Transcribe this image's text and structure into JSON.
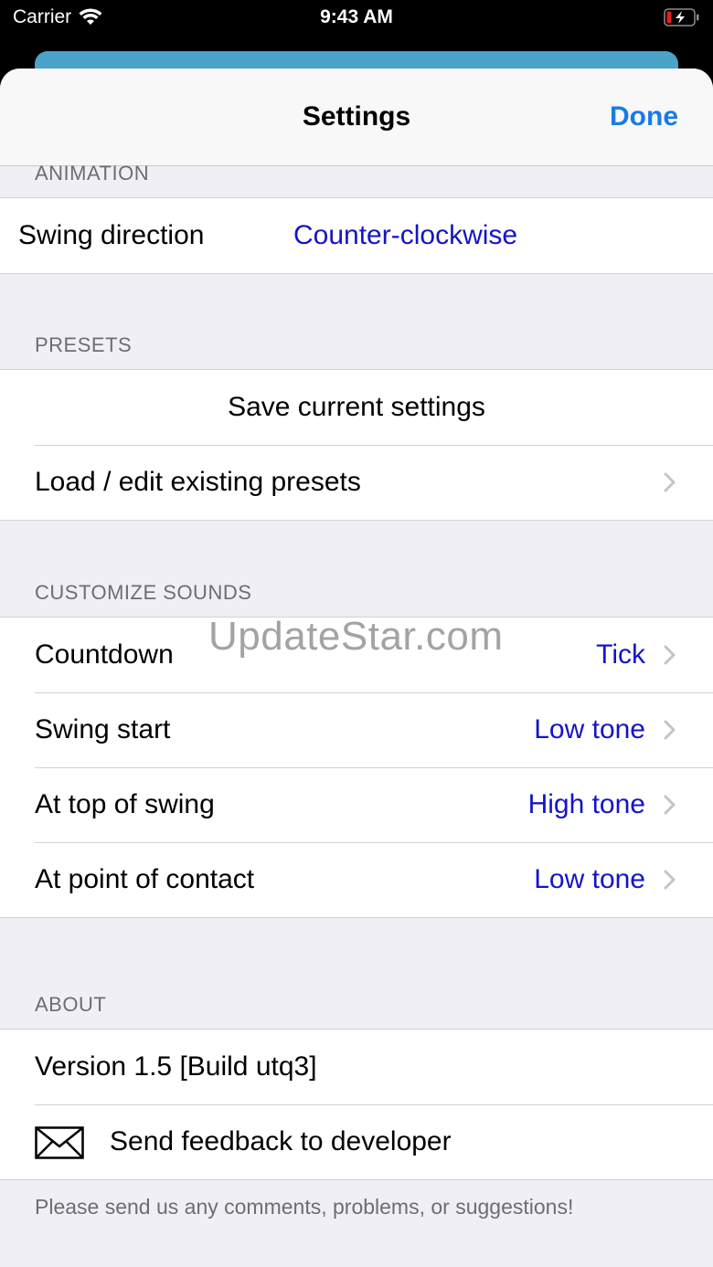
{
  "status": {
    "carrier": "Carrier",
    "time": "9:43 AM"
  },
  "nav": {
    "title": "Settings",
    "done": "Done"
  },
  "animation": {
    "header": "ANIMATION",
    "swing_direction_label": "Swing direction",
    "swing_direction_value": "Counter-clockwise"
  },
  "presets": {
    "header": "PRESETS",
    "save": "Save current settings",
    "load": "Load / edit existing presets"
  },
  "sounds": {
    "header": "CUSTOMIZE SOUNDS",
    "items": [
      {
        "label": "Countdown",
        "value": "Tick"
      },
      {
        "label": "Swing start",
        "value": "Low tone"
      },
      {
        "label": "At top of swing",
        "value": "High tone"
      },
      {
        "label": "At point of contact",
        "value": "Low tone"
      }
    ]
  },
  "about": {
    "header": "ABOUT",
    "version": "Version 1.5 [Build utq3]",
    "feedback": "Send feedback to developer",
    "footer": "Please send us any comments, problems, or suggestions!"
  },
  "watermark": "UpdateStar.com",
  "colors": {
    "accent": "#1a7be6",
    "value": "#1414c8",
    "background": "#f0eff5"
  }
}
